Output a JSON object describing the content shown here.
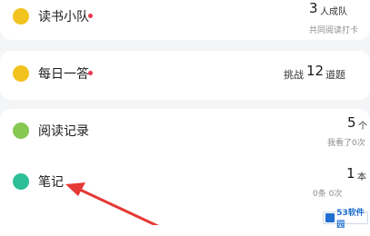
{
  "rows": [
    {
      "label": "读书小队",
      "has_dot": true,
      "value": "3",
      "unit": "人成队",
      "subtitle": "共同阅读打卡",
      "icon": "book-team-icon",
      "icon_color": "#f2c31f"
    },
    {
      "label": "每日一答",
      "has_dot": true,
      "value_prefix": "挑战",
      "value": "12",
      "unit": "道题",
      "icon": "daily-quiz-icon",
      "icon_color": "#f2c31f"
    },
    {
      "label": "阅读记录",
      "has_dot": false,
      "value": "5",
      "unit": "个",
      "subtitle": "我看了0次",
      "icon": "reading-record-icon",
      "icon_color": "#87c850"
    },
    {
      "label": "笔记",
      "has_dot": false,
      "value": "1",
      "unit": "本",
      "subtitle": "0条 0次",
      "icon": "notes-icon",
      "icon_color": "#2dbf97"
    }
  ],
  "watermark": {
    "text": "53软件园"
  },
  "colors": {
    "dot": "#e8384f",
    "arrow": "#e53935"
  }
}
